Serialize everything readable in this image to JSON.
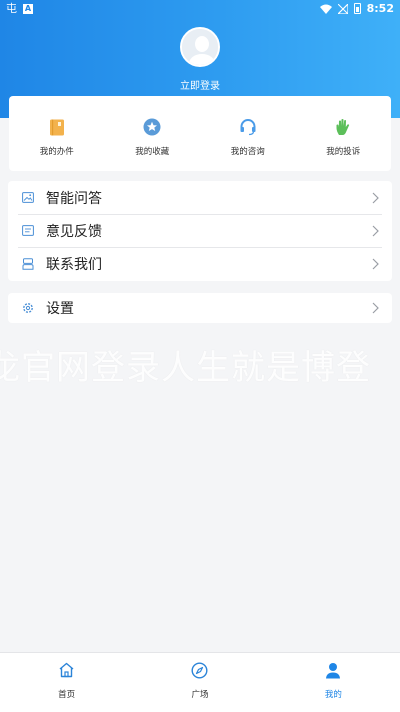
{
  "status_bar": {
    "left_glyph": "屯",
    "left_box": "A",
    "time": "8:52"
  },
  "profile": {
    "login_text": "立即登录"
  },
  "quick_actions": [
    {
      "label": "我的办件",
      "icon": "document-icon",
      "color": "#f0b14a"
    },
    {
      "label": "我的收藏",
      "icon": "star-badge-icon",
      "color": "#5a9bd8"
    },
    {
      "label": "我的咨询",
      "icon": "headset-icon",
      "color": "#4a9be8"
    },
    {
      "label": "我的投诉",
      "icon": "hand-icon",
      "color": "#5cbf5a"
    }
  ],
  "menu": {
    "items": [
      {
        "label": "智能问答",
        "icon": "image-icon"
      },
      {
        "label": "意见反馈",
        "icon": "feedback-icon"
      },
      {
        "label": "联系我们",
        "icon": "contact-icon"
      }
    ],
    "settings": {
      "label": "设置",
      "icon": "gear-icon"
    }
  },
  "watermark": "龙官网登录人生就是博登",
  "bottom_nav": [
    {
      "label": "首页",
      "icon": "home-icon"
    },
    {
      "label": "广场",
      "icon": "compass-icon"
    },
    {
      "label": "我的",
      "icon": "user-icon"
    }
  ],
  "colors": {
    "accent": "#1f86e6",
    "background": "#f4f5f7"
  }
}
